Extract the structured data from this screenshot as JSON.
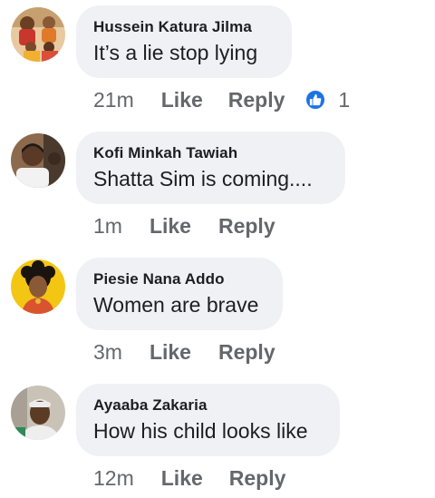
{
  "comments": [
    {
      "author": "Hussein Katura Jilma",
      "text": "It’s a lie stop lying",
      "time": "21m",
      "like_label": "Like",
      "reply_label": "Reply",
      "reaction_count": "1",
      "avatar": "group-photo-avatar"
    },
    {
      "author": "Kofi Minkah Tawiah",
      "text": "Shatta Sim is coming....",
      "time": "1m",
      "like_label": "Like",
      "reply_label": "Reply",
      "avatar": "man-portrait-avatar"
    },
    {
      "author": "Piesie Nana Addo",
      "text": "Women are brave",
      "time": "3m",
      "like_label": "Like",
      "reply_label": "Reply",
      "avatar": "woman-portrait-avatar"
    },
    {
      "author": "Ayaaba Zakaria",
      "text": "How his child looks like",
      "time": "12m",
      "like_label": "Like",
      "reply_label": "Reply",
      "avatar": "man-with-cap-avatar"
    }
  ],
  "colors": {
    "bubble": "#eff1f4",
    "name": "#1c1e21",
    "meta": "#65676b",
    "like_badge": "#1b74e4"
  }
}
